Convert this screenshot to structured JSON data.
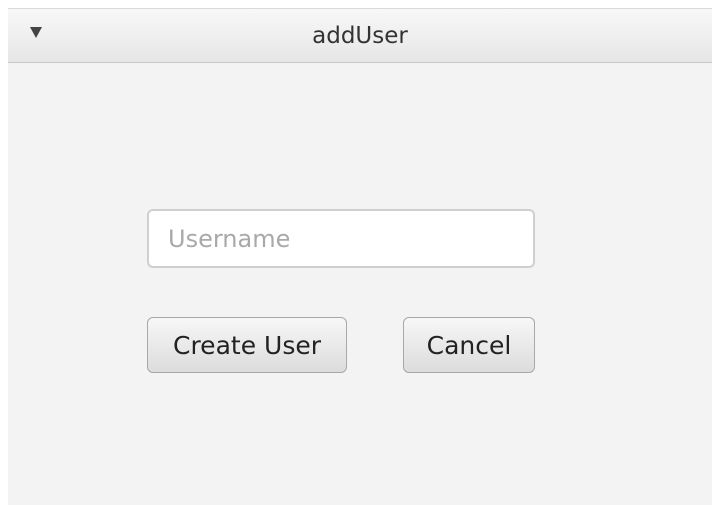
{
  "window": {
    "title": "addUser",
    "collapse_icon": "triangle-down-icon"
  },
  "form": {
    "username": {
      "value": "",
      "placeholder": "Username"
    },
    "create_button_label": "Create User",
    "cancel_button_label": "Cancel"
  }
}
